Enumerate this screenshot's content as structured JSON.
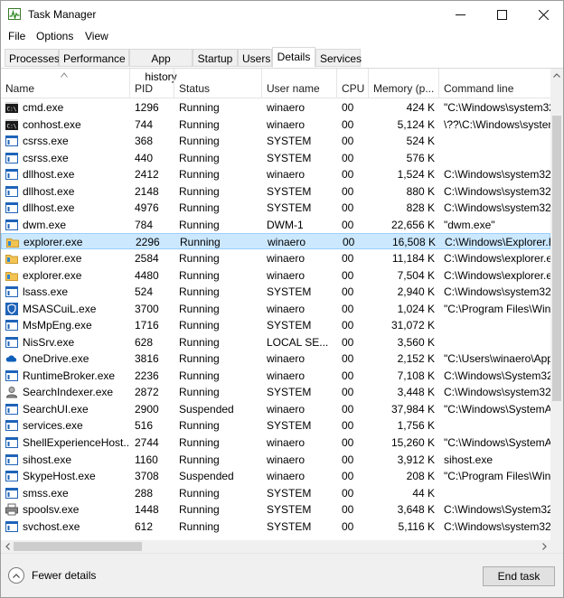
{
  "window": {
    "title": "Task Manager"
  },
  "menu": [
    {
      "label": "File"
    },
    {
      "label": "Options"
    },
    {
      "label": "View"
    }
  ],
  "tabs": [
    {
      "label": "Processes"
    },
    {
      "label": "Performance"
    },
    {
      "label": "App history"
    },
    {
      "label": "Startup"
    },
    {
      "label": "Users"
    },
    {
      "label": "Details",
      "active": true
    },
    {
      "label": "Services"
    }
  ],
  "columns": [
    "Name",
    "PID",
    "Status",
    "User name",
    "CPU",
    "Memory (p...",
    "Command line"
  ],
  "processes": [
    {
      "name": "cmd.exe",
      "pid": "1296",
      "status": "Running",
      "user": "winaero",
      "cpu": "00",
      "memory": "424 K",
      "cmd": "\"C:\\Windows\\system32",
      "icon": "console-icon"
    },
    {
      "name": "conhost.exe",
      "pid": "744",
      "status": "Running",
      "user": "winaero",
      "cpu": "00",
      "memory": "5,124 K",
      "cmd": "\\??\\C:\\Windows\\system",
      "icon": "console-icon"
    },
    {
      "name": "csrss.exe",
      "pid": "368",
      "status": "Running",
      "user": "SYSTEM",
      "cpu": "00",
      "memory": "524 K",
      "cmd": "",
      "icon": "app-window-icon"
    },
    {
      "name": "csrss.exe",
      "pid": "440",
      "status": "Running",
      "user": "SYSTEM",
      "cpu": "00",
      "memory": "576 K",
      "cmd": "",
      "icon": "app-window-icon"
    },
    {
      "name": "dllhost.exe",
      "pid": "2412",
      "status": "Running",
      "user": "winaero",
      "cpu": "00",
      "memory": "1,524 K",
      "cmd": "C:\\Windows\\system32",
      "icon": "app-window-icon"
    },
    {
      "name": "dllhost.exe",
      "pid": "2148",
      "status": "Running",
      "user": "SYSTEM",
      "cpu": "00",
      "memory": "880 K",
      "cmd": "C:\\Windows\\system32",
      "icon": "app-window-icon"
    },
    {
      "name": "dllhost.exe",
      "pid": "4976",
      "status": "Running",
      "user": "SYSTEM",
      "cpu": "00",
      "memory": "828 K",
      "cmd": "C:\\Windows\\system32",
      "icon": "app-window-icon"
    },
    {
      "name": "dwm.exe",
      "pid": "784",
      "status": "Running",
      "user": "DWM-1",
      "cpu": "00",
      "memory": "22,656 K",
      "cmd": "\"dwm.exe\"",
      "icon": "app-window-icon"
    },
    {
      "name": "explorer.exe",
      "pid": "2296",
      "status": "Running",
      "user": "winaero",
      "cpu": "00",
      "memory": "16,508 K",
      "cmd": "C:\\Windows\\Explorer.E",
      "icon": "folder-icon",
      "selected": true
    },
    {
      "name": "explorer.exe",
      "pid": "2584",
      "status": "Running",
      "user": "winaero",
      "cpu": "00",
      "memory": "11,184 K",
      "cmd": "C:\\Windows\\explorer.e",
      "icon": "folder-icon"
    },
    {
      "name": "explorer.exe",
      "pid": "4480",
      "status": "Running",
      "user": "winaero",
      "cpu": "00",
      "memory": "7,504 K",
      "cmd": "C:\\Windows\\explorer.e",
      "icon": "folder-icon"
    },
    {
      "name": "lsass.exe",
      "pid": "524",
      "status": "Running",
      "user": "SYSTEM",
      "cpu": "00",
      "memory": "2,940 K",
      "cmd": "C:\\Windows\\system32",
      "icon": "app-window-icon"
    },
    {
      "name": "MSASCuiL.exe",
      "pid": "3700",
      "status": "Running",
      "user": "winaero",
      "cpu": "00",
      "memory": "1,024 K",
      "cmd": "\"C:\\Program Files\\Win",
      "icon": "defender-icon"
    },
    {
      "name": "MsMpEng.exe",
      "pid": "1716",
      "status": "Running",
      "user": "SYSTEM",
      "cpu": "00",
      "memory": "31,072 K",
      "cmd": "",
      "icon": "app-window-icon"
    },
    {
      "name": "NisSrv.exe",
      "pid": "628",
      "status": "Running",
      "user": "LOCAL SE...",
      "cpu": "00",
      "memory": "3,560 K",
      "cmd": "",
      "icon": "app-window-icon"
    },
    {
      "name": "OneDrive.exe",
      "pid": "3816",
      "status": "Running",
      "user": "winaero",
      "cpu": "00",
      "memory": "2,152 K",
      "cmd": "\"C:\\Users\\winaero\\App",
      "icon": "cloud-icon"
    },
    {
      "name": "RuntimeBroker.exe",
      "pid": "2236",
      "status": "Running",
      "user": "winaero",
      "cpu": "00",
      "memory": "7,108 K",
      "cmd": "C:\\Windows\\System32",
      "icon": "app-window-icon"
    },
    {
      "name": "SearchIndexer.exe",
      "pid": "2872",
      "status": "Running",
      "user": "SYSTEM",
      "cpu": "00",
      "memory": "3,448 K",
      "cmd": "C:\\Windows\\system32",
      "icon": "search-indexer-icon"
    },
    {
      "name": "SearchUI.exe",
      "pid": "2900",
      "status": "Suspended",
      "user": "winaero",
      "cpu": "00",
      "memory": "37,984 K",
      "cmd": "\"C:\\Windows\\SystemA",
      "icon": "app-window-icon"
    },
    {
      "name": "services.exe",
      "pid": "516",
      "status": "Running",
      "user": "SYSTEM",
      "cpu": "00",
      "memory": "1,756 K",
      "cmd": "",
      "icon": "app-window-icon"
    },
    {
      "name": "ShellExperienceHost....",
      "pid": "2744",
      "status": "Running",
      "user": "winaero",
      "cpu": "00",
      "memory": "15,260 K",
      "cmd": "\"C:\\Windows\\SystemA",
      "icon": "app-window-icon"
    },
    {
      "name": "sihost.exe",
      "pid": "1160",
      "status": "Running",
      "user": "winaero",
      "cpu": "00",
      "memory": "3,912 K",
      "cmd": "sihost.exe",
      "icon": "app-window-icon"
    },
    {
      "name": "SkypeHost.exe",
      "pid": "3708",
      "status": "Suspended",
      "user": "winaero",
      "cpu": "00",
      "memory": "208 K",
      "cmd": "\"C:\\Program Files\\Win",
      "icon": "app-window-icon"
    },
    {
      "name": "smss.exe",
      "pid": "288",
      "status": "Running",
      "user": "SYSTEM",
      "cpu": "00",
      "memory": "44 K",
      "cmd": "",
      "icon": "app-window-icon"
    },
    {
      "name": "spoolsv.exe",
      "pid": "1448",
      "status": "Running",
      "user": "SYSTEM",
      "cpu": "00",
      "memory": "3,648 K",
      "cmd": "C:\\Windows\\System32",
      "icon": "printer-icon"
    },
    {
      "name": "svchost.exe",
      "pid": "612",
      "status": "Running",
      "user": "SYSTEM",
      "cpu": "00",
      "memory": "5,116 K",
      "cmd": "C:\\Windows\\system32",
      "icon": "app-window-icon"
    }
  ],
  "footer": {
    "fewer_details": "Fewer details",
    "end_task": "End task"
  },
  "colors": {
    "selected_row": "#cce8ff",
    "selected_border": "#99d1ff",
    "icon_blue": "#1e63b8"
  }
}
